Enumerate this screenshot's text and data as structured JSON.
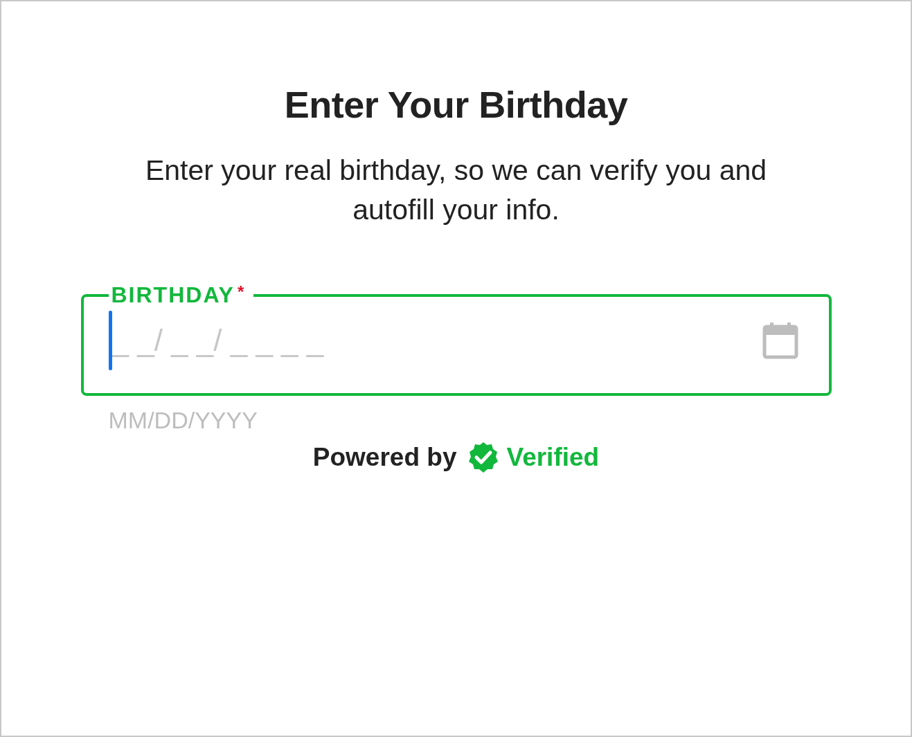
{
  "title": "Enter Your Birthday",
  "subtitle": "Enter your real birthday, so we can verify you and autofill your info.",
  "field": {
    "label": "BIRTHDAY",
    "required_mark": "*",
    "placeholder": "_ _/ _ _/ _ _ _ _",
    "focused": true,
    "helper": "MM/DD/YYYY"
  },
  "powered_by": {
    "text": "Powered by",
    "brand": "Verified"
  }
}
